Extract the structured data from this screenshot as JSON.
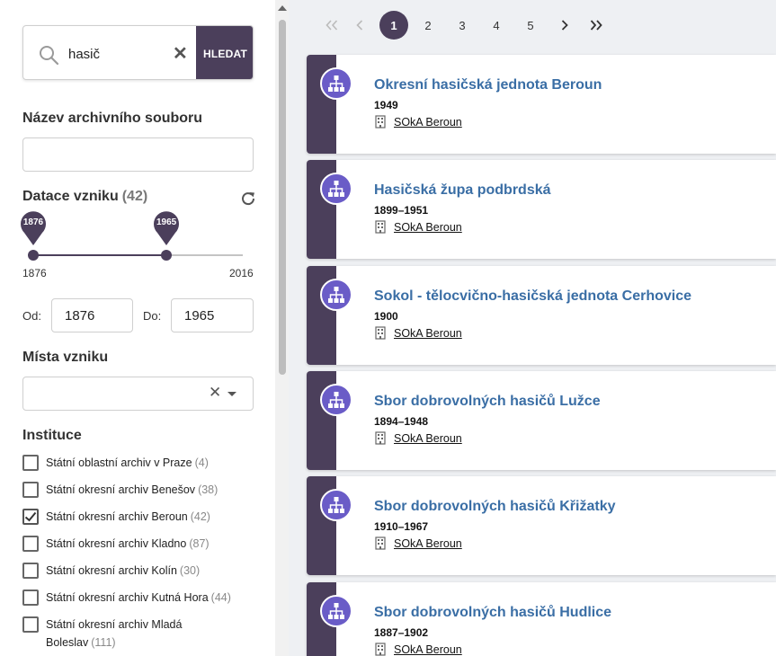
{
  "search": {
    "value": "hasič",
    "button_label": "HLEDAT"
  },
  "filters": {
    "name_title": "Název archivního souboru",
    "name_value": "",
    "dating_title": "Datace vzniku",
    "dating_count": "(42)",
    "slider": {
      "min": 1876,
      "max": 2016,
      "from": 1876,
      "to": 1965,
      "from_label": "1876",
      "to_label": "1965",
      "min_label": "1876",
      "max_label": "2016"
    },
    "from_label": "Od:",
    "from_value": "1876",
    "to_label": "Do:",
    "to_value": "1965",
    "places_title": "Místa vzniku",
    "places_value": "",
    "institutions_title": "Instituce",
    "institutions": [
      {
        "label": "Státní oblastní archiv v Praze",
        "count": "(4)",
        "checked": false
      },
      {
        "label": "Státní okresní archiv Benešov",
        "count": "(38)",
        "checked": false
      },
      {
        "label": "Státní okresní archiv Beroun",
        "count": "(42)",
        "checked": true
      },
      {
        "label": "Státní okresní archiv Kladno",
        "count": "(87)",
        "checked": false
      },
      {
        "label": "Státní okresní archiv Kolín",
        "count": "(30)",
        "checked": false
      },
      {
        "label": "Státní okresní archiv Kutná Hora",
        "count": "(44)",
        "checked": false
      },
      {
        "label": "Státní okresní archiv Mladá Boleslav",
        "count": "(111)",
        "checked": false
      }
    ]
  },
  "pagination": {
    "first": "«",
    "prev": "‹",
    "pages": [
      "1",
      "2",
      "3",
      "4",
      "5"
    ],
    "active": "1",
    "next": "›",
    "last": "»"
  },
  "results": [
    {
      "title": "Okresní hasičská jednota Beroun",
      "date": "1949",
      "institution": "SOkA Beroun"
    },
    {
      "title": "Hasičská župa podbrdská",
      "date": "1899–1951",
      "institution": "SOkA Beroun"
    },
    {
      "title": "Sokol - tělocvično-hasičská jednota Cerhovice",
      "date": "1900",
      "institution": "SOkA Beroun"
    },
    {
      "title": "Sbor dobrovolných hasičů Lužce",
      "date": "1894–1948",
      "institution": "SOkA Beroun"
    },
    {
      "title": "Sbor dobrovolných hasičů Křižatky",
      "date": "1910–1967",
      "institution": "SOkA Beroun"
    },
    {
      "title": "Sbor dobrovolných hasičů Hudlice",
      "date": "1887–1902",
      "institution": "SOkA Beroun"
    }
  ],
  "colors": {
    "accent": "#4b3f5b",
    "icon_bg": "#6a5cc7",
    "title_link": "#3a6ea5"
  },
  "icons": {
    "search": "magnifier-icon",
    "clear": "close-icon",
    "reset": "refresh-icon",
    "result": "hierarchy-icon",
    "institution": "building-icon"
  }
}
